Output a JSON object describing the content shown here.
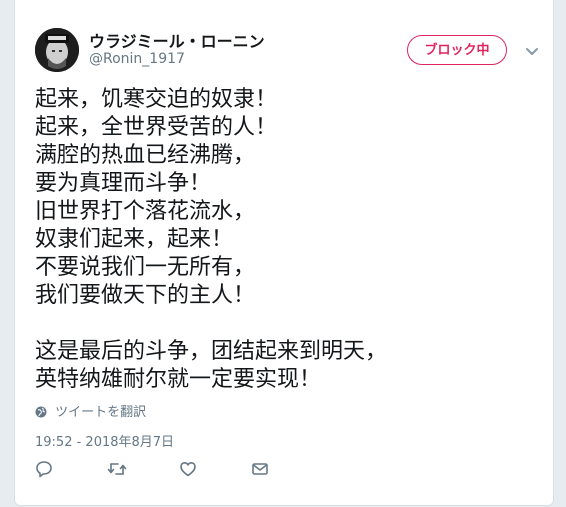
{
  "author": {
    "display_name": "ウラジミール・ローニン",
    "handle": "@Ronin_1917"
  },
  "block_button_label": "ブロック中",
  "tweet_lines": [
    "起来，饥寒交迫的奴隶！",
    "起来，全世界受苦的人！",
    "满腔的热血已经沸腾，",
    "要为真理而斗争！",
    "旧世界打个落花流水，",
    "奴隶们起来，起来！",
    "不要说我们一无所有，",
    "我们要做天下的主人！",
    "",
    "这是最后的斗争，团结起来到明天，",
    "英特纳雄耐尔就一定要实现！"
  ],
  "translate_label": "ツイートを翻訳",
  "timestamp": "19:52 - 2018年8月7日",
  "icons": {
    "caret": "chevron-down-icon",
    "reply": "reply-icon",
    "retweet": "retweet-icon",
    "like": "heart-icon",
    "dm": "envelope-icon",
    "translate": "globe-icon"
  },
  "colors": {
    "block_red": "#e0245e",
    "secondary_text": "#657786",
    "primary_text": "#14171a"
  }
}
